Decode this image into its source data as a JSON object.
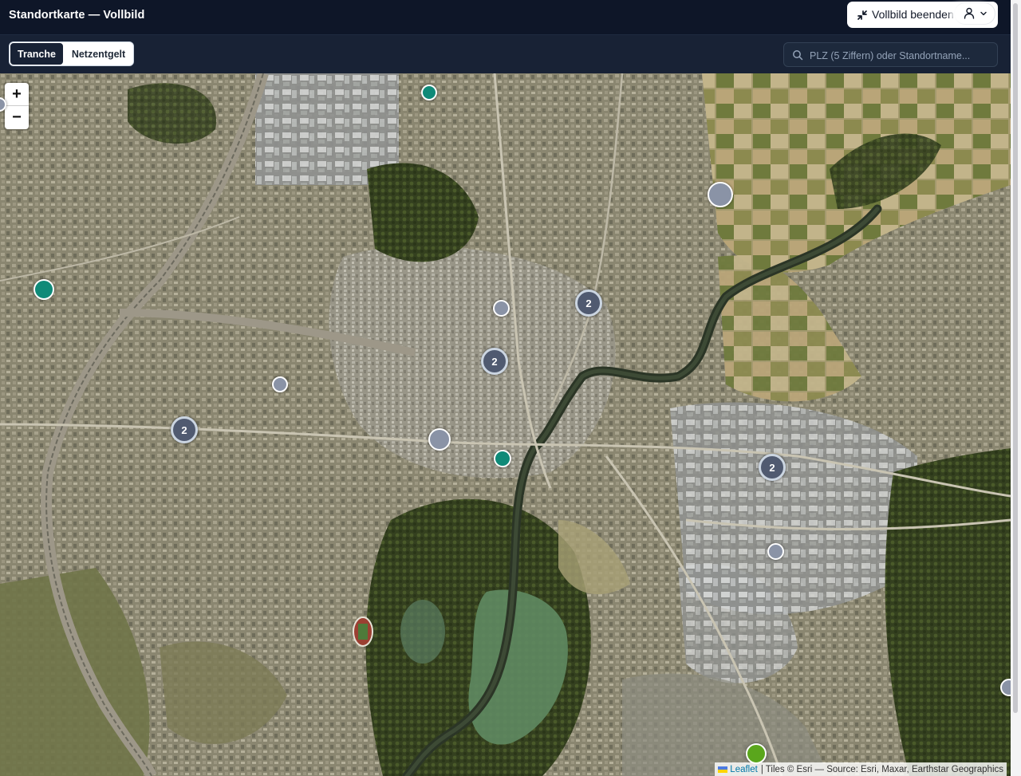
{
  "header": {
    "title": "Standortkarte — Vollbild",
    "exit_fullscreen_label": "Vollbild beenden"
  },
  "toolbar": {
    "tabs": [
      {
        "label": "Tranche",
        "active": true
      },
      {
        "label": "Netzentgelt",
        "active": false
      }
    ],
    "search": {
      "placeholder": "PLZ (5 Ziffern) oder Standortname...",
      "value": ""
    }
  },
  "map": {
    "zoom_in": "+",
    "zoom_out": "−",
    "clusters": [
      {
        "count": "2"
      },
      {
        "count": "2"
      },
      {
        "count": "2"
      },
      {
        "count": "2"
      }
    ],
    "site_marker_colors": {
      "teal": "#0f8a78",
      "grey": "#8a93a6",
      "green": "#5aa61c",
      "cluster": "#505a70"
    },
    "attribution": {
      "leaflet": "Leaflet",
      "text": "| Tiles © Esri — Source: Esri, Maxar, Earthstar Geographics"
    }
  }
}
